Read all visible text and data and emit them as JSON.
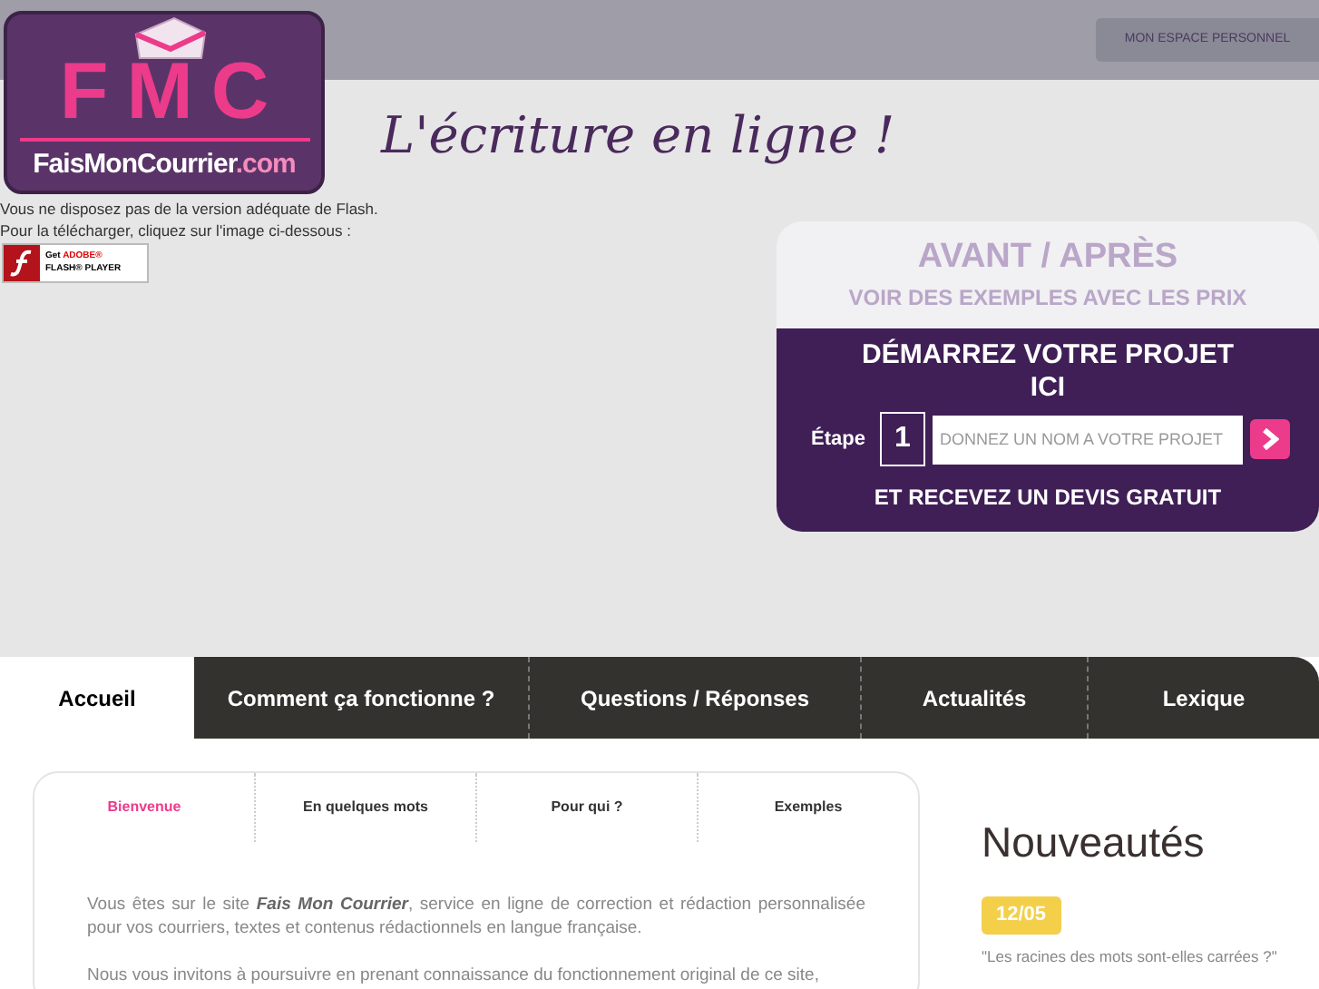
{
  "header": {
    "account_button": "MON ESPACE PERSONNEL"
  },
  "logo": {
    "letters": "FMC",
    "name": "FaisMonCourrier",
    "tld": ".com"
  },
  "tagline": "L'écriture en ligne !",
  "flash_notice": [
    "Vous ne disposez pas de la version adéquate de Flash.",
    "Pour la télécharger, cliquez sur l'image ci-dessous :"
  ],
  "flash_badge": {
    "get": "Get",
    "brand": "ADOBE®",
    "product": "FLASH® PLAYER"
  },
  "promo": {
    "title": "AVANT / APRÈS",
    "subtitle": "VOIR DES EXEMPLES AVEC LES PRIX",
    "cta": "DÉMARREZ VOTRE PROJET ICI",
    "step_label": "Étape",
    "step_number": "1",
    "input_placeholder": "DONNEZ UN NOM A VOTRE PROJET",
    "footer": "ET RECEVEZ UN DEVIS GRATUIT"
  },
  "nav": [
    {
      "label": "Accueil",
      "selected": true
    },
    {
      "label": "Comment ça fonctionne ?",
      "selected": false
    },
    {
      "label": "Questions / Réponses",
      "selected": false
    },
    {
      "label": "Actualités",
      "selected": false
    },
    {
      "label": "Lexique",
      "selected": false
    }
  ],
  "subtabs": [
    {
      "label": "Bienvenue",
      "selected": true
    },
    {
      "label": "En quelques mots",
      "selected": false
    },
    {
      "label": "Pour qui ?",
      "selected": false
    },
    {
      "label": "Exemples",
      "selected": false
    }
  ],
  "paragraphs": [
    "Vous êtes sur le site **Fais Mon Courrier**, service en ligne de correction et rédaction personnalisée pour vos courriers, textes et contenus rédactionnels en langue française.",
    "Nous vous invitons à poursuivre en prenant connaissance du fonctionnement original de ce site,"
  ],
  "news": {
    "title": "Nouveautés",
    "items": [
      {
        "date": "12/05",
        "text": "\"Les racines des mots sont-elles carrées ?\""
      }
    ]
  }
}
